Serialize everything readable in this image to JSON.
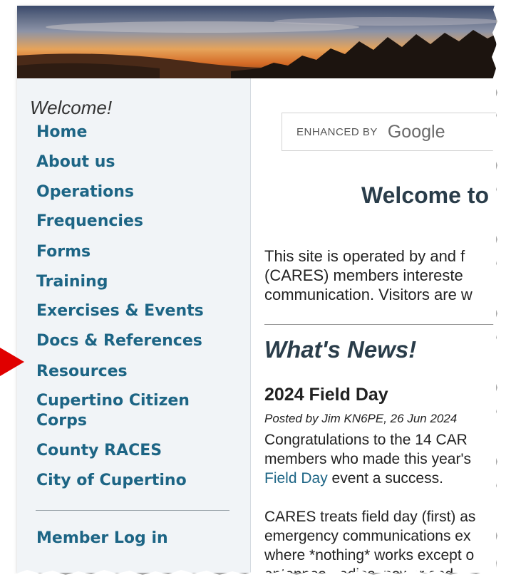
{
  "colors": {
    "link": "#1d6585",
    "heading": "#2a3d4a",
    "sidebar_bg": "#f1f4f7",
    "arrow": "#e00000"
  },
  "sidebar": {
    "welcome": "Welcome!",
    "items": [
      {
        "label": "Home"
      },
      {
        "label": "About us"
      },
      {
        "label": "Operations"
      },
      {
        "label": "Frequencies"
      },
      {
        "label": "Forms"
      },
      {
        "label": "Training"
      },
      {
        "label": "Exercises & Events"
      },
      {
        "label": "Docs & References"
      },
      {
        "label": "Resources"
      },
      {
        "label": "Cupertino Citizen Corps"
      },
      {
        "label": "County RACES"
      },
      {
        "label": "City of Cupertino"
      }
    ],
    "member_login": "Member Log in"
  },
  "search": {
    "enhanced_by": "ENHANCED BY",
    "brand": "Google"
  },
  "main": {
    "title": "Welcome to",
    "intro_lines": [
      "This site is operated by and f",
      "(CARES) members intereste",
      "communication. Visitors are w"
    ],
    "news_heading": "What's News!",
    "post": {
      "title": "2024 Field Day",
      "meta": "Posted by Jim  KN6PE, 26 Jun 2024",
      "line1": "Congratulations to the 14 CAR",
      "line2": "members who made this year's",
      "link_text": "Field Day",
      "line3_rest": " event a success.",
      "para2": [
        "CARES treats field day (first) as",
        "emergency communications ex",
        "where *nothing* works except o",
        "antennas, radios, power and"
      ]
    }
  }
}
